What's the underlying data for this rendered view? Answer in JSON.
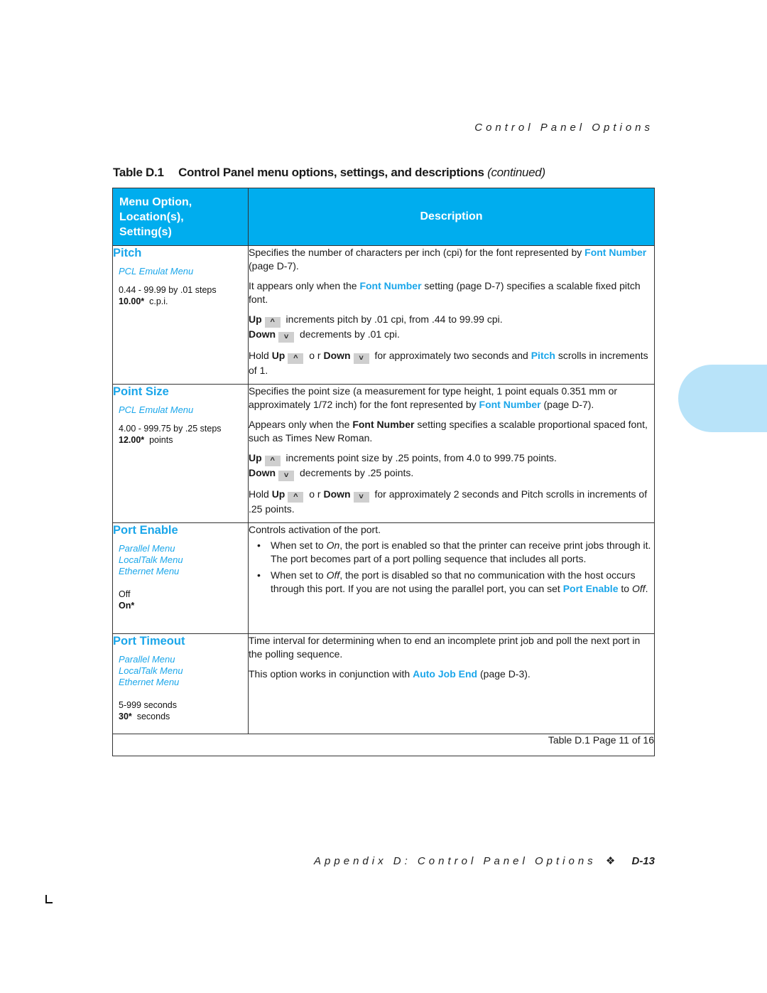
{
  "running_header": "Control Panel Options",
  "caption": {
    "number": "Table D.1",
    "title": "Control Panel menu options, settings, and descriptions",
    "continued": "(continued)"
  },
  "table": {
    "header": {
      "col1_lines": [
        "Menu Option,",
        "Location(s),",
        "Setting(s)"
      ],
      "col2": "Description"
    },
    "rows": [
      {
        "option": "Pitch",
        "locations": [
          "PCL Emulat Menu"
        ],
        "settings": [
          {
            "value": "0.44 - 99.99 by .01 steps",
            "default": false,
            "unit": ""
          },
          {
            "value": "10.00*",
            "default": true,
            "unit": "c.p.i."
          }
        ],
        "desc": {
          "p1_a": "Specifies the number of characters per inch (cpi) for the font represented by ",
          "p1_link": "Font Number",
          "p1_b": " (page D-7).",
          "p2_a": "It appears only when the ",
          "p2_link": "Font Number",
          "p2_b": " setting (page D-7) specifies a scalable fixed pitch font.",
          "up_label": "Up",
          "up_text": " increments pitch by  .01 cpi, from .44 to 99.99 cpi.",
          "down_label": "Down",
          "down_text": " decrements by  .01 cpi.",
          "hold_a": "Hold ",
          "hold_up": "Up",
          "hold_or": " o r ",
          "hold_down": "Down",
          "hold_b": " for approximately two seconds and ",
          "hold_link": "Pitch",
          "hold_c": " scrolls in increments of 1."
        }
      },
      {
        "option": "Point Size",
        "locations": [
          "PCL Emulat Menu"
        ],
        "settings": [
          {
            "value": "4.00 - 999.75 by .25 steps",
            "default": false,
            "unit": ""
          },
          {
            "value": "12.00*",
            "default": true,
            "unit": "points"
          }
        ],
        "desc": {
          "p1_a": "Specifies the point size (a measurement for type height, 1 point equals 0.351 mm or approximately 1/72 inch) for the font represented by ",
          "p1_link": "Font Number",
          "p1_b": " (page D-7).",
          "p2_a": "Appears only when the ",
          "p2_bold": "Font Number",
          "p2_b": " setting specifies a scalable proportional spaced font, such as Times New Roman.",
          "up_label": "Up",
          "up_text": " increments point size by  .25 points, from 4.0 to 999.75 points.",
          "down_label": "Down",
          "down_text": " decrements by .25 points.",
          "hold_a": "Hold ",
          "hold_up": "Up",
          "hold_or": " o r ",
          "hold_down": "Down",
          "hold_b": " for approximately 2 seconds and Pitch scrolls in increments of .25 points."
        }
      },
      {
        "option": "Port Enable",
        "locations": [
          "Parallel Menu",
          "LocalTalk Menu",
          "Ethernet Menu"
        ],
        "settings": [
          {
            "value": "Off",
            "default": false,
            "unit": ""
          },
          {
            "value": "On*",
            "default": true,
            "unit": ""
          }
        ],
        "desc": {
          "intro": "Controls activation of the port.",
          "b1_a": "When set to ",
          "b1_em": "On",
          "b1_b": ", the port is enabled so that the printer can receive print jobs through it. The port becomes part of a port polling sequence that includes all ports.",
          "b2_a": "When set to ",
          "b2_em": "Off",
          "b2_b": ", the port is disabled so that no communication with the host occurs through this port. If you are not using the parallel port, you can set ",
          "b2_link": "Port Enable",
          "b2_c": " to ",
          "b2_em2": "Off",
          "b2_d": "."
        }
      },
      {
        "option": "Port Timeout",
        "locations": [
          "Parallel Menu",
          "LocalTalk Menu",
          "Ethernet Menu"
        ],
        "settings": [
          {
            "value": "5-999 seconds",
            "default": false,
            "unit": ""
          },
          {
            "value": "30*",
            "default": true,
            "unit": "seconds"
          }
        ],
        "desc": {
          "p1": "Time interval for determining when to end an incomplete print job and poll the next port in the polling sequence.",
          "p2_a": "This option works in conjunction with ",
          "p2_link": "Auto Job End",
          "p2_b": " (page D-3)."
        }
      }
    ],
    "footer": "Table D.1  Page 11 of 16"
  },
  "keys": {
    "up_glyph": "^",
    "down_glyph": "˅"
  },
  "running_footer": {
    "text": "Appendix D: Control Panel Options",
    "separator": "❖",
    "page": "D-13"
  },
  "colors": {
    "header_bg": "#00adee",
    "link": "#1aa6ea",
    "thumb_tab": "#b8e3f9"
  }
}
